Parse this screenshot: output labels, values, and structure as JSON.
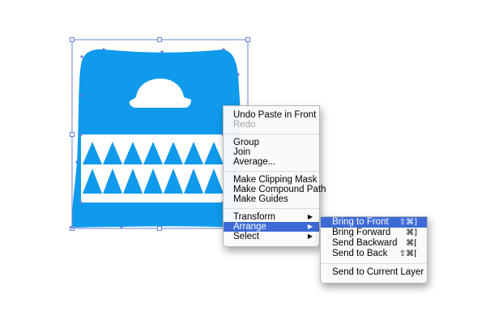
{
  "colors": {
    "shape_fill": "#0f9aeb",
    "highlight": "#3d6bd6",
    "selection": "#6680d8"
  },
  "context_menu": {
    "groups": [
      [
        {
          "label": "Undo Paste in Front",
          "enabled": true
        },
        {
          "label": "Redo",
          "enabled": false
        }
      ],
      [
        {
          "label": "Group",
          "enabled": true
        },
        {
          "label": "Join",
          "enabled": true
        },
        {
          "label": "Average...",
          "enabled": true
        }
      ],
      [
        {
          "label": "Make Clipping Mask",
          "enabled": true
        },
        {
          "label": "Make Compound Path",
          "enabled": true
        },
        {
          "label": "Make Guides",
          "enabled": true
        }
      ],
      [
        {
          "label": "Transform",
          "enabled": true,
          "submenu": true
        },
        {
          "label": "Arrange",
          "enabled": true,
          "submenu": true,
          "highlighted": true
        },
        {
          "label": "Select",
          "enabled": true,
          "submenu": true
        }
      ]
    ]
  },
  "arrange_submenu": {
    "groups": [
      [
        {
          "label": "Bring to Front",
          "shortcut": "⇧⌘]",
          "highlighted": true
        },
        {
          "label": "Bring Forward",
          "shortcut": "⌘]"
        },
        {
          "label": "Send Backward",
          "shortcut": "⌘["
        },
        {
          "label": "Send to Back",
          "shortcut": "⇧⌘["
        }
      ],
      [
        {
          "label": "Send to Current Layer",
          "shortcut": ""
        }
      ]
    ]
  }
}
